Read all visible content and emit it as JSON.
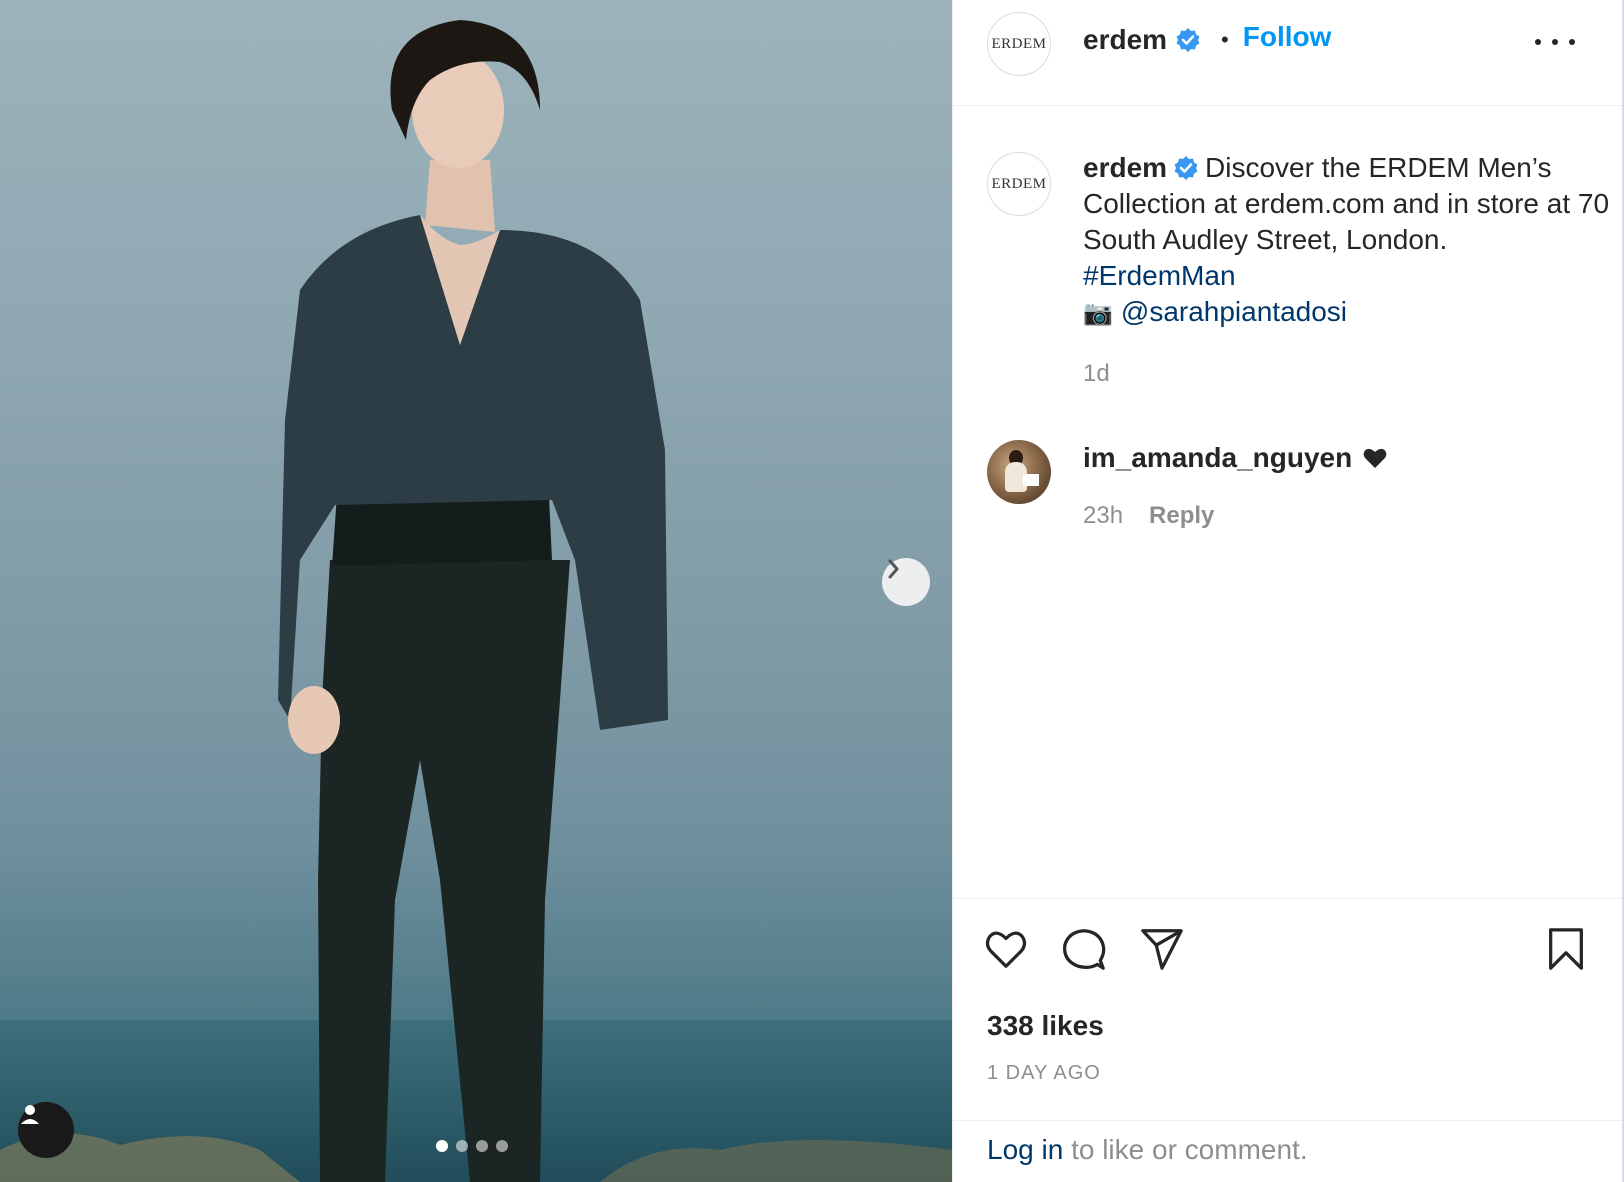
{
  "post": {
    "account": {
      "username": "erdem",
      "logo_text": "ERDEM",
      "verified": true,
      "follow_label": "Follow",
      "follow_color": "#0095f6"
    },
    "caption": {
      "username": "erdem",
      "text": "Discover the ERDEM Men’s Collection at erdem.com and in store at 70 South Audley Street, London.",
      "hashtag": "#ErdemMan",
      "camera_icon": "📷",
      "mention": "@sarahpiantadosi",
      "time": "1d"
    },
    "comments": [
      {
        "username": "im_amanda_nguyen",
        "text_icon": "black-heart-icon",
        "time": "23h",
        "reply_label": "Reply"
      }
    ],
    "likes": "338 likes",
    "posted_ago": "1 DAY AGO",
    "login": {
      "link": "Log in",
      "rest": " to like or comment."
    }
  },
  "media": {
    "carousel_index": 1,
    "carousel_count": 4
  },
  "colors": {
    "link_dark": "#00376b",
    "muted": "#8e8e8e",
    "text": "#262626"
  }
}
